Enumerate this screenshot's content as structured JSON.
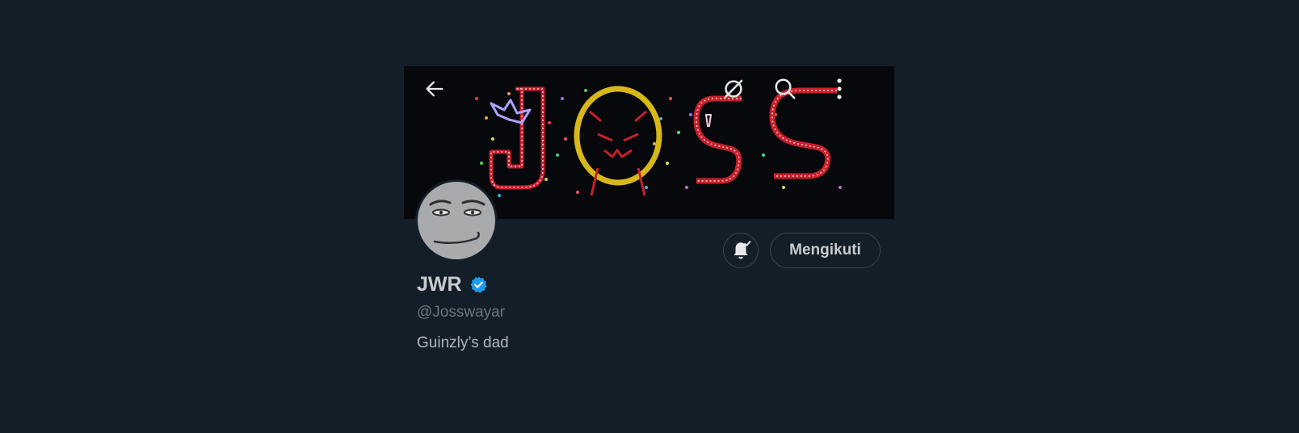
{
  "banner": {
    "text": "JOSS",
    "background": "#06080c",
    "accent_red": "#c8202a",
    "accent_yellow": "#d8b818"
  },
  "header": {
    "back_icon": "arrow-left-icon",
    "grok_icon": "grok-icon",
    "search_icon": "search-icon",
    "more_icon": "more-vertical-icon"
  },
  "profile": {
    "display_name": "JWR",
    "verified": true,
    "verified_color": "#1d9bf0",
    "handle": "@Josswayar",
    "bio": "Guinzly’s dad"
  },
  "actions": {
    "notification_icon": "bell-check-icon",
    "follow_label": "Mengikuti"
  },
  "colors": {
    "page_background": "#141e28",
    "text_primary": "#c9cccf",
    "text_secondary": "#6b747c",
    "border": "#3c4650"
  }
}
